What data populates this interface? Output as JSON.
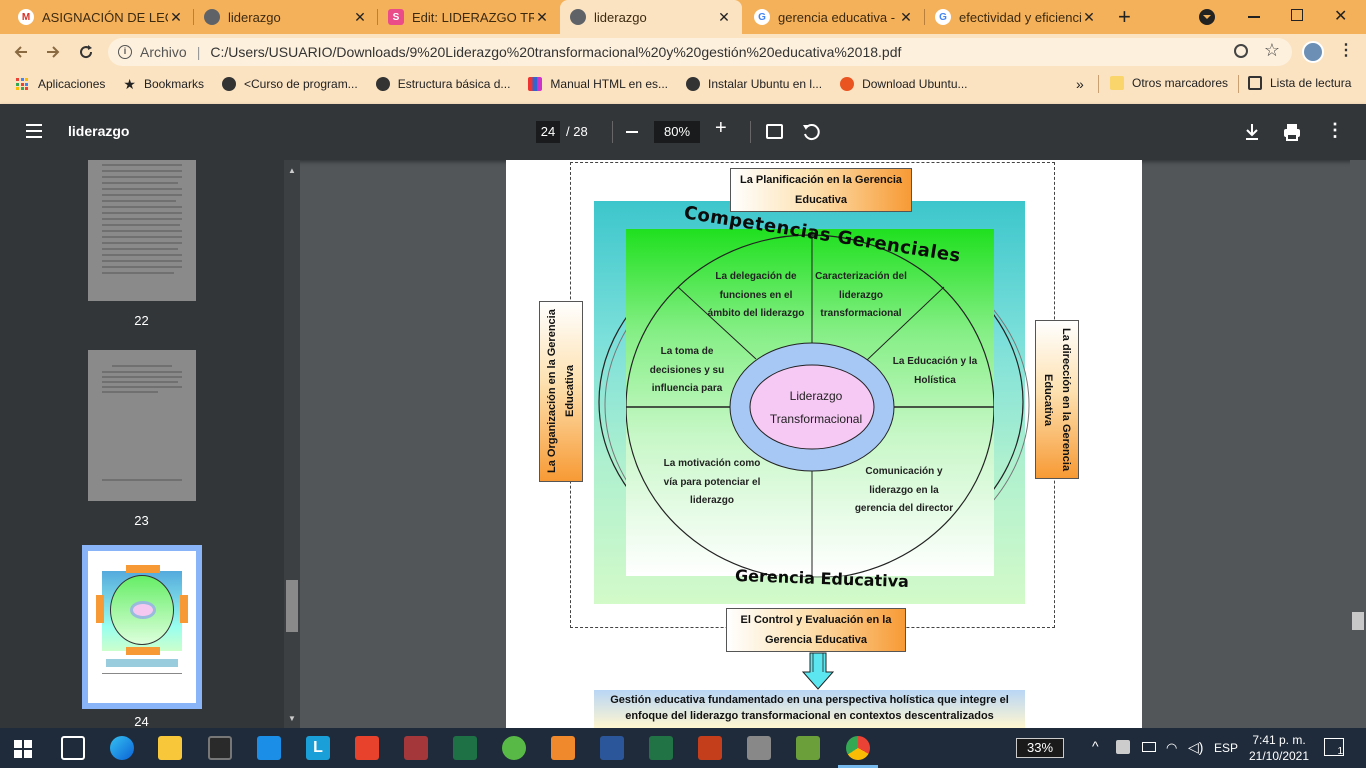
{
  "tabs": [
    {
      "title": "ASIGNACIÓN DE LECT",
      "favicon_color": "#d93025",
      "favicon": "M"
    },
    {
      "title": "liderazgo",
      "favicon_color": "#5f6368",
      "favicon": "◉"
    },
    {
      "title": "Edit: LIDERAZGO TRAN",
      "favicon_color": "#ea4c89",
      "favicon": "S"
    },
    {
      "title": "liderazgo",
      "favicon_color": "#5f6368",
      "favicon": "◉"
    },
    {
      "title": "gerencia educativa - B",
      "favicon_color": "#4285f4",
      "favicon": "G"
    },
    {
      "title": "efectividad y eficiencia",
      "favicon_color": "#4285f4",
      "favicon": "G"
    }
  ],
  "new_tab": "+",
  "close_glyph": "✕",
  "address": {
    "prefix": "Archivo",
    "url": "C:/Users/USUARIO/Downloads/9%20Liderazgo%20transformacional%20y%20gestión%20educativa%2018.pdf"
  },
  "bookmarks": [
    {
      "label": "Aplicaciones",
      "icon": "apps-icon"
    },
    {
      "label": "Bookmarks",
      "icon": "star-icon"
    },
    {
      "label": "<Curso de program...",
      "icon": "globe-icon"
    },
    {
      "label": "Estructura básica d...",
      "icon": "globe-icon"
    },
    {
      "label": "Manual HTML en es...",
      "icon": "bars-icon"
    },
    {
      "label": "Instalar Ubuntu en l...",
      "icon": "globe-icon"
    },
    {
      "label": "Download Ubuntu...",
      "icon": "ubuntu-icon"
    }
  ],
  "bookmarks_more": "»",
  "other_bookmarks": "Otros marcadores",
  "reading_list": "Lista de lectura",
  "pdf": {
    "title": "liderazgo",
    "page": "24",
    "total": "/ 28",
    "zoom": "80%"
  },
  "thumbs": [
    {
      "label": "22"
    },
    {
      "label": "23"
    },
    {
      "label": "24"
    }
  ],
  "diagram": {
    "top_box": "La Planificación en la Gerencia Educativa",
    "left_box": "La Organización en la Gerencia Educativa",
    "right_box": "La dirección en la Gerencia Educativa",
    "bottom_box": "El Control y Evaluación en la Gerencia Educativa",
    "arc_top": "Competencias Gerenciales",
    "arc_bottom": "Gerencia Educativa",
    "center": [
      "Liderazgo",
      "Transformacional"
    ],
    "segments": [
      [
        "La delegación de",
        "funciones en el",
        "ámbito del liderazgo"
      ],
      [
        "Caracterización del",
        "liderazgo",
        "transformacional"
      ],
      [
        "La toma de",
        "decisiones y su",
        "influencia para"
      ],
      [
        "La Educación y la",
        "Holística"
      ],
      [
        "La motivación como",
        "vía para potenciar el",
        "liderazgo"
      ],
      [
        "Comunicación y",
        "liderazgo en la",
        "gerencia del director"
      ]
    ],
    "footer": [
      "Gestión educativa fundamentado en una perspectiva holística que integre el",
      "enfoque del liderazgo transformacional en contextos descentralizados"
    ]
  },
  "taskbar": {
    "battery": "33%",
    "lang": "ESP",
    "time": "7:41 p. m.",
    "date": "21/10/2021",
    "notif": "1"
  }
}
